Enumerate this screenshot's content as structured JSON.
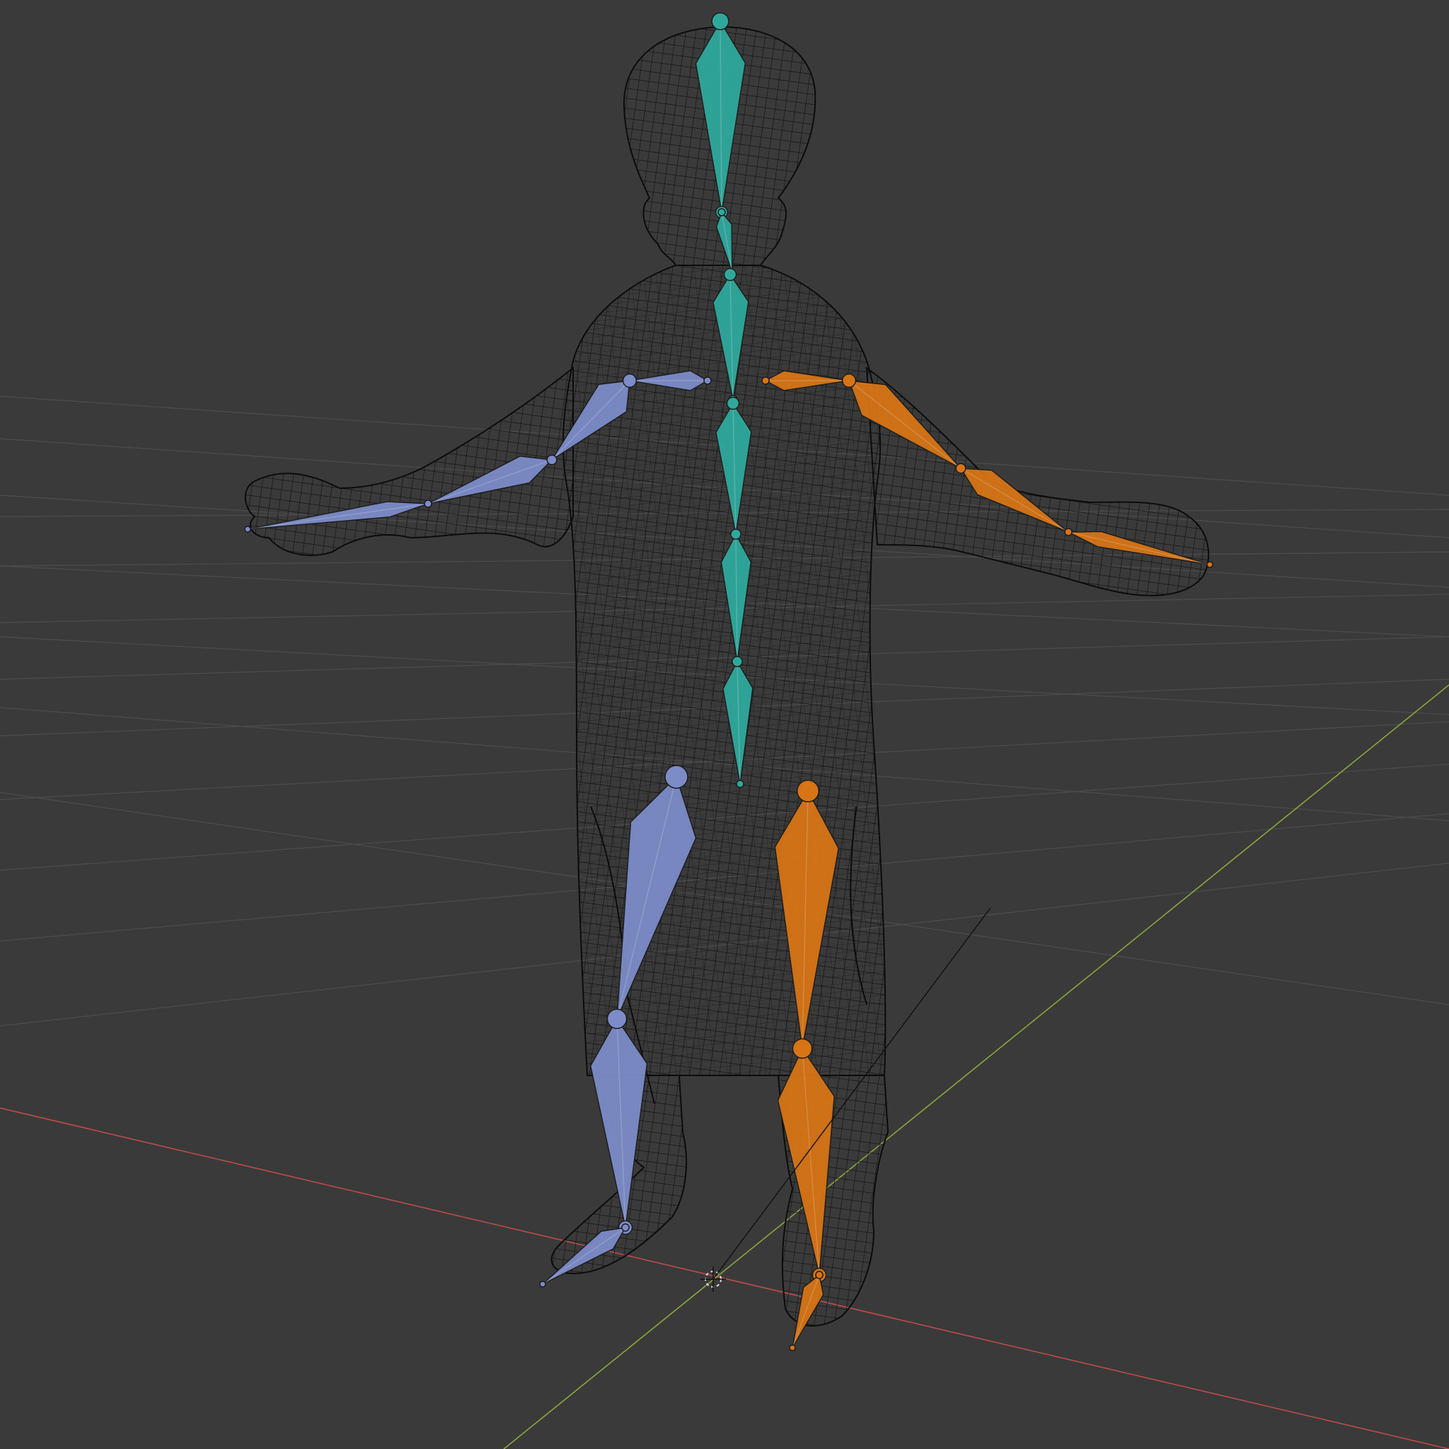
{
  "viewport": {
    "background": "#3a3a3a",
    "grid_color": "#4a4a4a",
    "x_axis_color": "#c04a4a",
    "y_axis_color": "#8aa83a",
    "wire_color": "#0f0f0f"
  },
  "armature": {
    "center_color": "#2fa89c",
    "left_color": "#7c8cc8",
    "right_color": "#d67416",
    "bones": [
      {
        "name": "head",
        "side": "center"
      },
      {
        "name": "neck",
        "side": "center"
      },
      {
        "name": "spine-upper",
        "side": "center"
      },
      {
        "name": "spine-mid",
        "side": "center"
      },
      {
        "name": "spine-lower",
        "side": "center"
      },
      {
        "name": "hips",
        "side": "center"
      },
      {
        "name": "shoulder",
        "side": "left"
      },
      {
        "name": "upper-arm",
        "side": "left"
      },
      {
        "name": "forearm",
        "side": "left"
      },
      {
        "name": "hand",
        "side": "left"
      },
      {
        "name": "thigh",
        "side": "left"
      },
      {
        "name": "shin",
        "side": "left"
      },
      {
        "name": "foot",
        "side": "left"
      },
      {
        "name": "shoulder",
        "side": "right"
      },
      {
        "name": "upper-arm",
        "side": "right"
      },
      {
        "name": "forearm",
        "side": "right"
      },
      {
        "name": "hand",
        "side": "right"
      },
      {
        "name": "thigh",
        "side": "right"
      },
      {
        "name": "shin",
        "side": "right"
      },
      {
        "name": "foot",
        "side": "right"
      }
    ]
  }
}
